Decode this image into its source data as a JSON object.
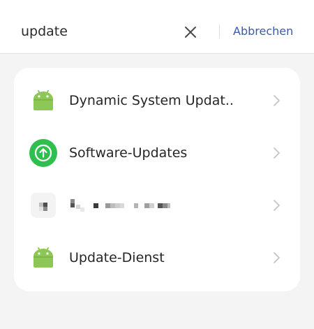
{
  "search": {
    "query": "update",
    "cancel_label": "Abbrechen"
  },
  "results": [
    {
      "label": "Dynamic System Updat..",
      "icon": "android-icon"
    },
    {
      "label": "Software-Updates",
      "icon": "upload-arrow-icon",
      "accent": "#2fbf4f"
    },
    {
      "label": "",
      "icon": "blurred-app-icon",
      "redacted": true
    },
    {
      "label": "Update-Dienst",
      "icon": "android-icon"
    }
  ],
  "colors": {
    "android": "#8dc755",
    "accent_link": "#3a59a8"
  }
}
